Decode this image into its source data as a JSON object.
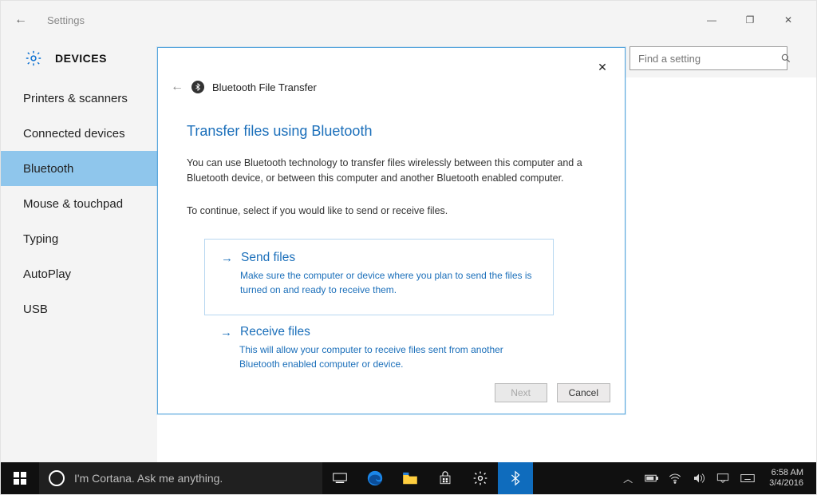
{
  "titlebar": {
    "app_name": "Settings",
    "win_minimize": "—",
    "win_restore": "❐",
    "win_close": "✕"
  },
  "header": {
    "section": "DEVICES",
    "search_placeholder": "Find a setting"
  },
  "sidebar": {
    "items": [
      {
        "label": "Printers & scanners"
      },
      {
        "label": "Connected devices"
      },
      {
        "label": "Bluetooth"
      },
      {
        "label": "Mouse & touchpad"
      },
      {
        "label": "Typing"
      },
      {
        "label": "AutoPlay"
      },
      {
        "label": "USB"
      }
    ],
    "selected_index": 2
  },
  "dialog": {
    "title": "Bluetooth File Transfer",
    "heading": "Transfer files using Bluetooth",
    "intro1": "You can use Bluetooth technology to transfer files wirelessly between this computer and a Bluetooth device, or between this computer and another Bluetooth enabled computer.",
    "intro2": "To continue, select if you would like to send or receive files.",
    "options": [
      {
        "title": "Send files",
        "desc": "Make sure the computer or device where you plan to send the files is turned on and ready to receive them."
      },
      {
        "title": "Receive files",
        "desc": "This will allow your computer to receive files sent from another Bluetooth enabled computer or device."
      }
    ],
    "buttons": {
      "next": "Next",
      "cancel": "Cancel"
    }
  },
  "taskbar": {
    "cortana_prompt": "I'm Cortana. Ask me anything.",
    "clock_time": "6:58 AM",
    "clock_date": "3/4/2016"
  }
}
